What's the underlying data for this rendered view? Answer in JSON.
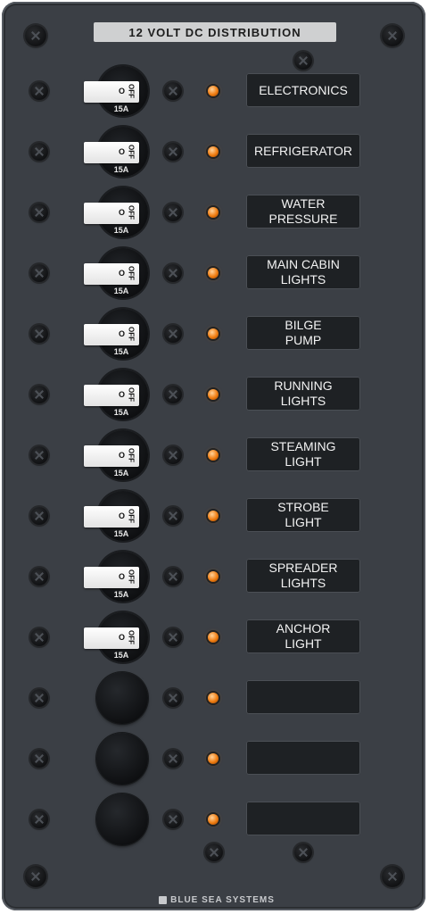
{
  "panel": {
    "title": "12 VOLT DC DISTRIBUTION",
    "brand": "BLUE SEA SYSTEMS"
  },
  "breaker": {
    "off_text": "OFF",
    "on_mark": "O",
    "rating": "15A"
  },
  "circuits": [
    {
      "label": "ELECTRONICS",
      "has_breaker": true
    },
    {
      "label": "REFRIGERATOR",
      "has_breaker": true
    },
    {
      "label": "WATER\nPRESSURE",
      "has_breaker": true
    },
    {
      "label": "MAIN CABIN\nLIGHTS",
      "has_breaker": true
    },
    {
      "label": "BILGE\nPUMP",
      "has_breaker": true
    },
    {
      "label": "RUNNING\nLIGHTS",
      "has_breaker": true
    },
    {
      "label": "STEAMING\nLIGHT",
      "has_breaker": true
    },
    {
      "label": "STROBE\nLIGHT",
      "has_breaker": true
    },
    {
      "label": "SPREADER\nLIGHTS",
      "has_breaker": true
    },
    {
      "label": "ANCHOR\nLIGHT",
      "has_breaker": true
    },
    {
      "label": "",
      "has_breaker": false
    },
    {
      "label": "",
      "has_breaker": false
    },
    {
      "label": "",
      "has_breaker": false
    }
  ],
  "colors": {
    "panel": "#3b3f45",
    "led": "#f07c10",
    "label_bg": "#1e2124"
  }
}
